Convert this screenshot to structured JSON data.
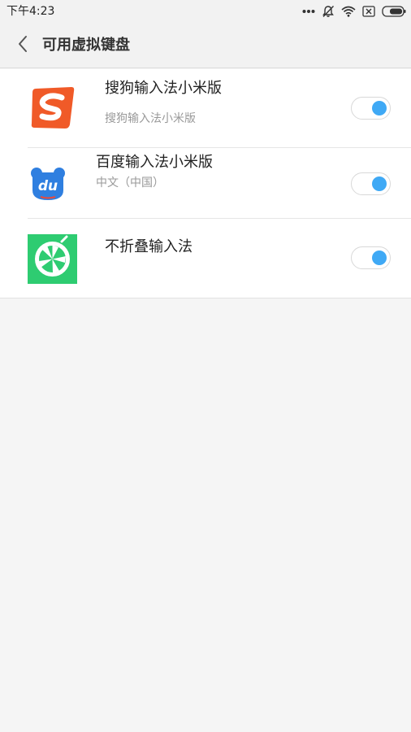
{
  "status_bar": {
    "time": "下午4:23",
    "icons": [
      "more-dots-icon",
      "bell-muted-icon",
      "wifi-icon",
      "sim-none-icon",
      "battery-icon"
    ]
  },
  "header": {
    "back_icon": "chevron-left-icon",
    "title": "可用虚拟键盘"
  },
  "keyboards": [
    {
      "name": "搜狗输入法小米版",
      "subtitle": "搜狗输入法小米版",
      "icon": "sogou-app-icon",
      "enabled": true
    },
    {
      "name": "百度输入法小米版",
      "subtitle": "中文（中国）",
      "icon": "baidu-app-icon",
      "enabled": true
    },
    {
      "name": "不折叠输入法",
      "subtitle": "",
      "icon": "buzhedie-app-icon",
      "enabled": true
    }
  ],
  "colors": {
    "toggle_on": "#3fa9f5",
    "sogou": "#f05a28",
    "baidu": "#2f7fe0",
    "buzhedie": "#2ecc71"
  }
}
